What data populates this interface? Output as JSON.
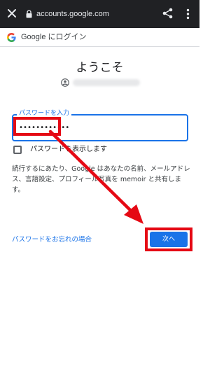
{
  "browser": {
    "url": "accounts.google.com",
    "icons": [
      "close-icon",
      "lock-icon",
      "share-icon",
      "more-vert-icon"
    ]
  },
  "header": {
    "title": "Google にログイン",
    "logo": "google-g-logo"
  },
  "main": {
    "welcome": "ようこそ",
    "password_label": "パスワードを入力",
    "password_value": "••••••••••••",
    "show_password_label": "パスワードを表示します",
    "notice": "続行するにあたり、Google はあなたの名前、メールアドレス、言語設定、プロフィール写真を memoir と共有します。",
    "forgot_link": "パスワードをお忘れの場合",
    "next_button": "次へ"
  },
  "colors": {
    "accent": "#1a73e8",
    "annotation": "#e50914",
    "topbar": "#202124"
  }
}
